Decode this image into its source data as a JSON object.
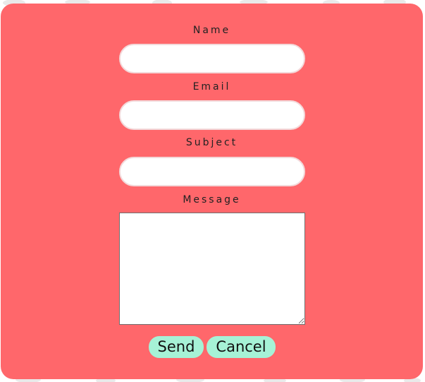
{
  "form": {
    "name_label": "Name",
    "name_value": "",
    "email_label": "Email",
    "email_value": "",
    "subject_label": "Subject",
    "subject_value": "",
    "message_label": "Message",
    "message_value": "",
    "send_label": "Send",
    "cancel_label": "Cancel"
  },
  "colors": {
    "card_background": "#ff676b",
    "button_background": "#a6f2d6",
    "label_text": "#222222",
    "input_background": "#ffffff"
  }
}
